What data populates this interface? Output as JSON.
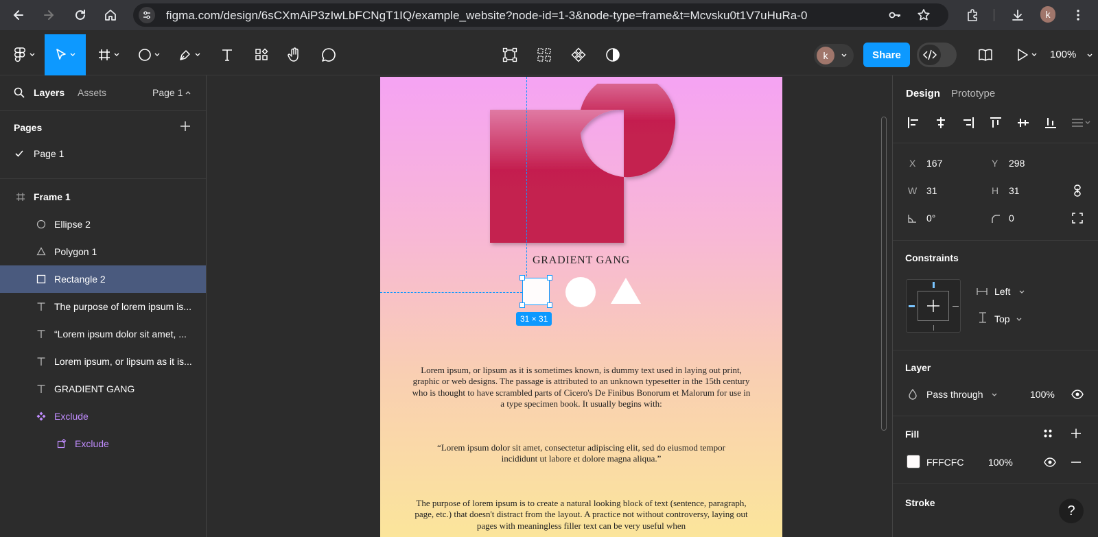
{
  "browser": {
    "url": "figma.com/design/6sCXmAiP3zIwLbFCNgT1IQ/example_website?node-id=1-3&node-type=frame&t=Mcvsku0t1V7uHuRa-0",
    "profile_initial": "k"
  },
  "toolbar": {
    "avatar_initial": "k",
    "share_label": "Share",
    "zoom": "100%"
  },
  "left_panel": {
    "tabs": {
      "layers": "Layers",
      "assets": "Assets",
      "page_selector": "Page 1"
    },
    "pages_title": "Pages",
    "pages": [
      {
        "label": "Page 1",
        "checked": true
      }
    ],
    "layers": [
      {
        "label": "Frame 1",
        "icon": "frame-icon",
        "indent": 0,
        "selected": false,
        "bold": true
      },
      {
        "label": "Ellipse 2",
        "icon": "ellipse-icon",
        "indent": 1,
        "selected": false
      },
      {
        "label": "Polygon 1",
        "icon": "polygon-icon",
        "indent": 1,
        "selected": false
      },
      {
        "label": "Rectangle 2",
        "icon": "rectangle-icon",
        "indent": 1,
        "selected": true
      },
      {
        "label": "The purpose of lorem ipsum is...",
        "icon": "text-icon",
        "indent": 1,
        "selected": false
      },
      {
        "label": "“Lorem ipsum dolor sit amet, ...",
        "icon": "text-icon",
        "indent": 1,
        "selected": false
      },
      {
        "label": "Lorem ipsum, or lipsum as it is...",
        "icon": "text-icon",
        "indent": 1,
        "selected": false
      },
      {
        "label": "GRADIENT GANG",
        "icon": "text-icon",
        "indent": 1,
        "selected": false
      },
      {
        "label": "Exclude",
        "icon": "component-icon",
        "indent": 1,
        "selected": false,
        "purple": true
      },
      {
        "label": "Exclude",
        "icon": "instance-icon",
        "indent": 2,
        "selected": false,
        "purple": true
      }
    ]
  },
  "canvas": {
    "frame_title": "GRADIENT GANG",
    "size_badge": "31 × 31",
    "paragraph1": "Lorem ipsum, or lipsum as it is sometimes known, is dummy text used in laying out print, graphic or web designs. The passage is attributed to an unknown typesetter in the 15th century who is thought to have scrambled parts of Cicero's De Finibus Bonorum et Malorum for use in a type specimen book. It usually begins with:",
    "quote": "“Lorem ipsum dolor sit amet, consectetur adipiscing elit, sed do eiusmod tempor incididunt ut labore et dolore magna aliqua.”",
    "paragraph3": "The purpose of lorem ipsum is to create a natural looking block of text (sentence, paragraph, page, etc.) that doesn't distract from the layout. A practice not without controversy, laying out pages with meaningless filler text can be very useful when"
  },
  "right_panel": {
    "tabs": {
      "design": "Design",
      "prototype": "Prototype"
    },
    "position": {
      "x_label": "X",
      "x": "167",
      "y_label": "Y",
      "y": "298",
      "w_label": "W",
      "w": "31",
      "h_label": "H",
      "h": "31",
      "rotation": "0°",
      "radius": "0"
    },
    "constraints": {
      "title": "Constraints",
      "horizontal": "Left",
      "vertical": "Top"
    },
    "layer": {
      "title": "Layer",
      "blend": "Pass through",
      "opacity": "100%"
    },
    "fill": {
      "title": "Fill",
      "hex": "FFFCFC",
      "opacity": "100%",
      "color": "#FFFCFC"
    },
    "stroke": {
      "title": "Stroke"
    }
  },
  "help_label": "?"
}
